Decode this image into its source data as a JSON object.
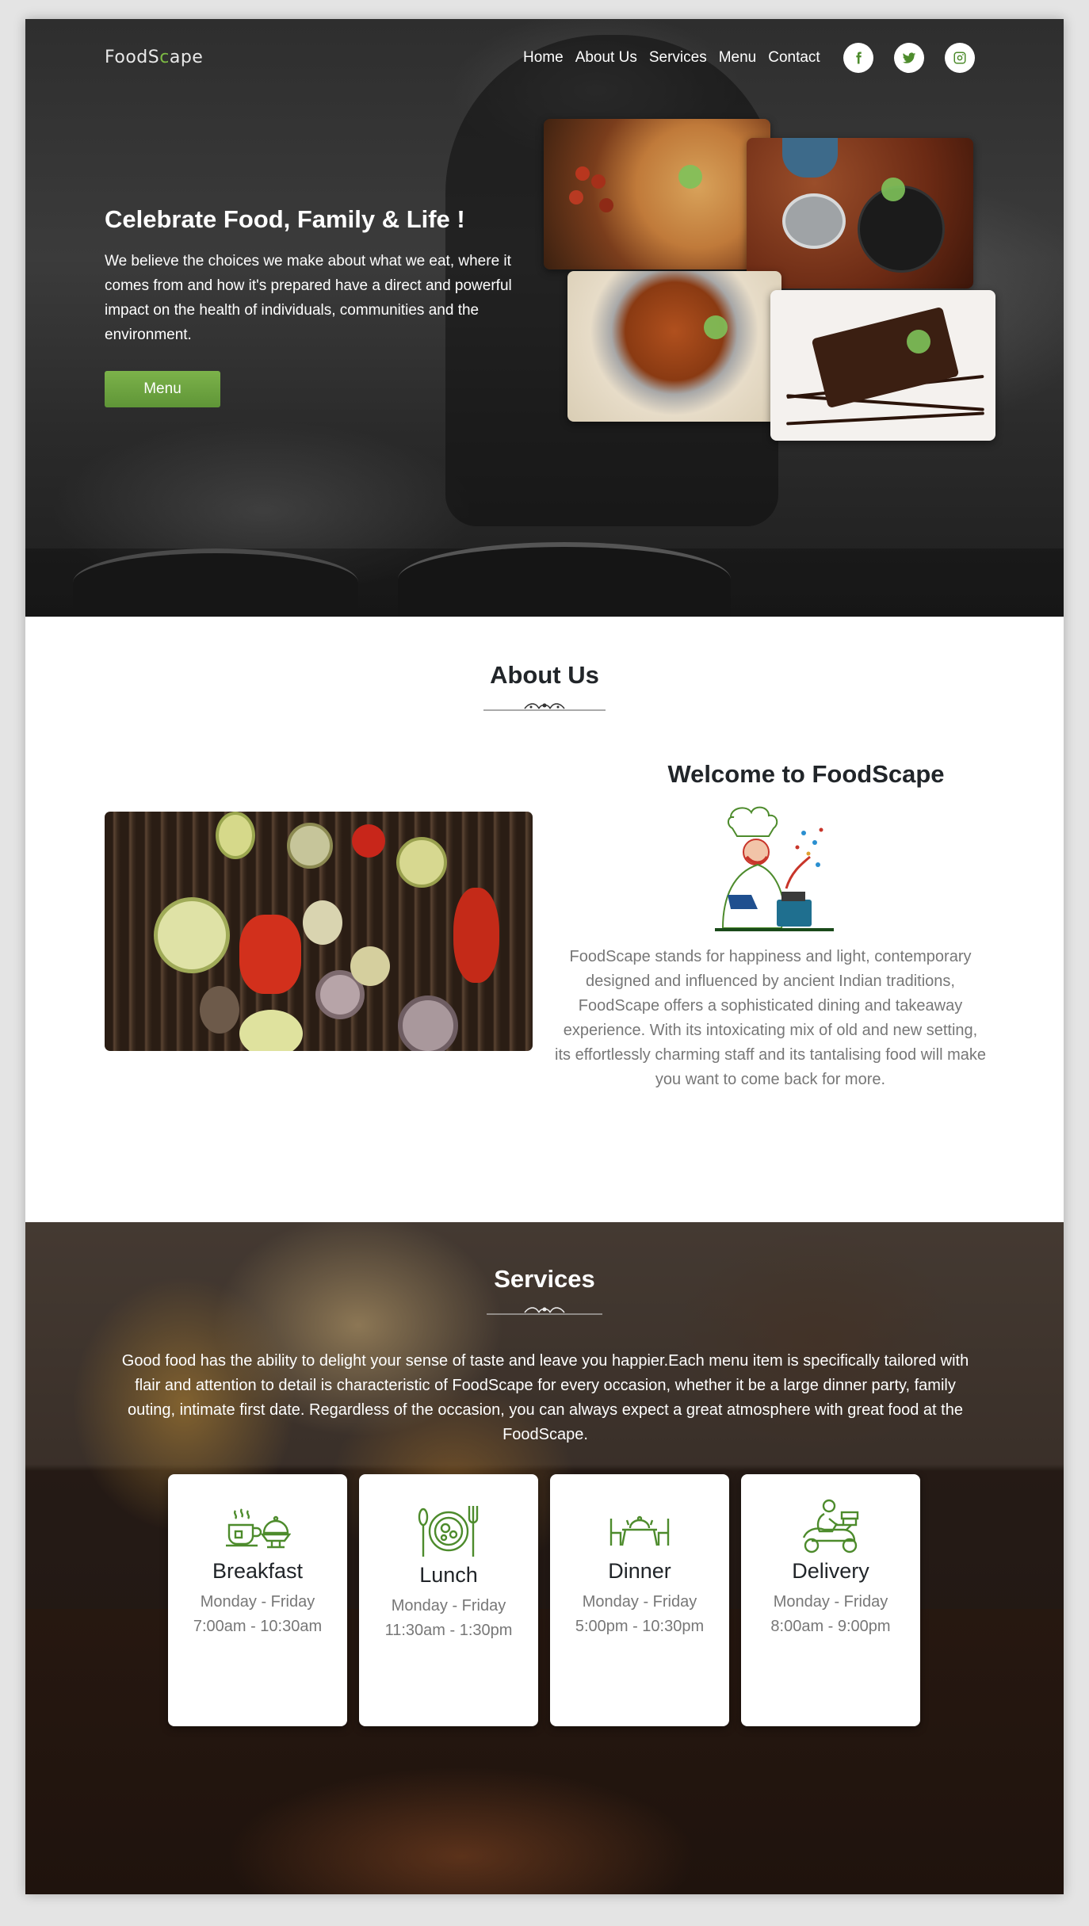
{
  "brand": {
    "logo_main": "FoodS",
    "logo_accent": "c",
    "logo_rest": "ape",
    "accent_color": "#7dbb44"
  },
  "nav": {
    "items": [
      "Home",
      "About Us",
      "Services",
      "Menu",
      "Contact"
    ]
  },
  "social": {
    "icons": [
      "facebook-icon",
      "twitter-icon",
      "instagram-icon"
    ]
  },
  "hero": {
    "title": "Celebrate Food, Family & Life !",
    "text": "We believe the choices we make about what we eat, where it comes from and how it's prepared have a direct and powerful impact on the health of individuals, communities and the environment.",
    "button": "Menu",
    "gallery": [
      "pizza",
      "tea",
      "curry",
      "chocolate-cake"
    ]
  },
  "about": {
    "title": "About Us",
    "welcome": "Welcome to FoodScape",
    "text": "FoodScape stands for happiness and light, contemporary designed and influenced by ancient Indian traditions, FoodScape offers a sophisticated dining and takeaway experience. With its intoxicating mix of old and new setting, its effortlessly charming staff and its tantalising food will make you want to come back for more."
  },
  "services": {
    "title": "Services",
    "text": "Good food has the ability to delight your sense of taste and leave you happier.Each menu item is specifically tailored with flair and attention to detail is characteristic of FoodScape for every occasion, whether it be a large dinner party, family outing, intimate first date. Regardless of the occasion, you can always expect a great atmosphere with great food at the FoodScape.",
    "cards": [
      {
        "name": "Breakfast",
        "days": "Monday - Friday",
        "hours": "7:00am - 10:30am",
        "icon": "breakfast-icon"
      },
      {
        "name": "Lunch",
        "days": "Monday - Friday",
        "hours": "11:30am - 1:30pm",
        "icon": "lunch-icon"
      },
      {
        "name": "Dinner",
        "days": "Monday - Friday",
        "hours": "5:00pm - 10:30pm",
        "icon": "dinner-icon"
      },
      {
        "name": "Delivery",
        "days": "Monday - Friday",
        "hours": "8:00am - 9:00pm",
        "icon": "delivery-icon"
      }
    ]
  },
  "colors": {
    "green": "#5f9537",
    "icon_green": "#4d8b2c",
    "text_muted": "#777777",
    "heading": "#212529"
  }
}
